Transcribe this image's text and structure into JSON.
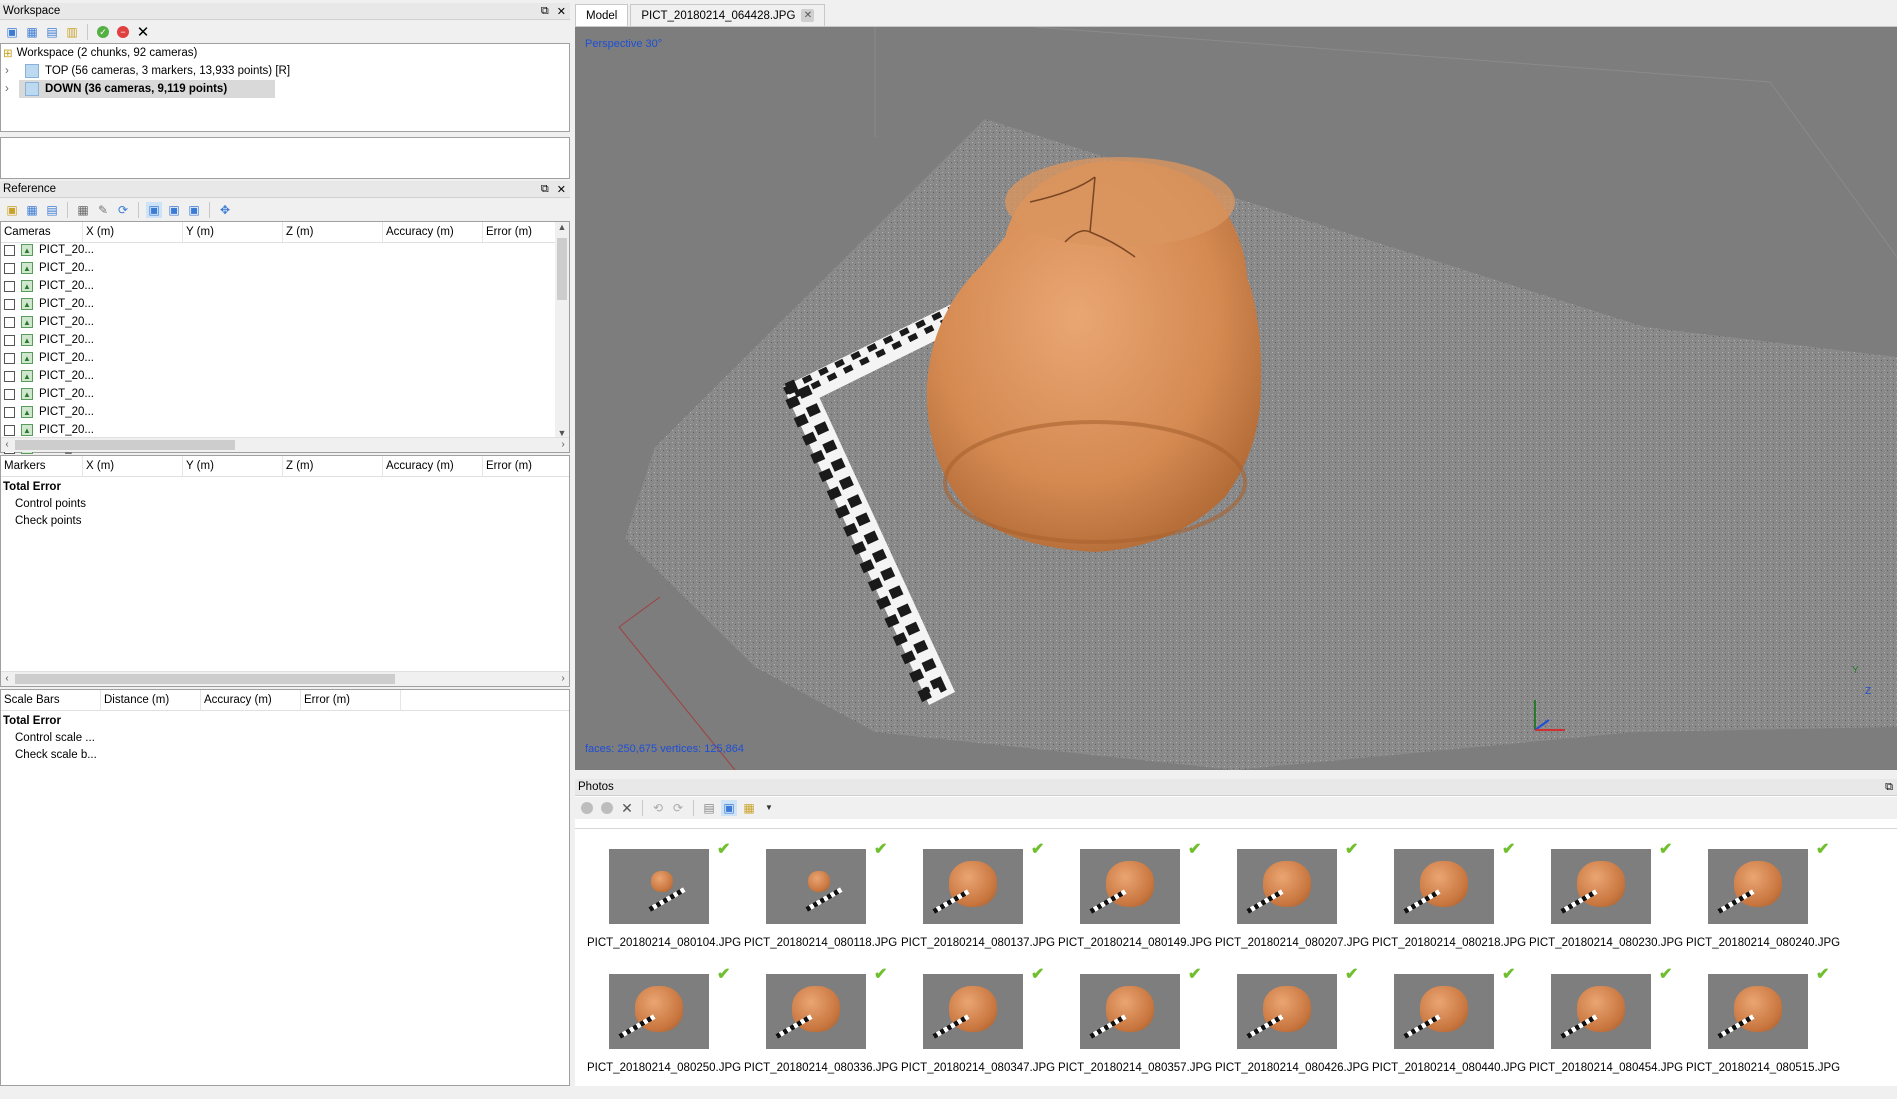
{
  "workspace": {
    "title": "Workspace",
    "root": "Workspace (2 chunks, 92 cameras)",
    "chunks": [
      {
        "label": "TOP (56 cameras, 3 markers, 13,933 points) [R]",
        "bold": false
      },
      {
        "label": "DOWN (36 cameras, 9,119 points)",
        "bold": true
      }
    ]
  },
  "reference": {
    "title": "Reference",
    "camera_columns": [
      "Cameras",
      "X (m)",
      "Y (m)",
      "Z (m)",
      "Accuracy (m)",
      "Error (m)"
    ],
    "cameras": [
      "PICT_20...",
      "PICT_20...",
      "PICT_20...",
      "PICT_20...",
      "PICT_20...",
      "PICT_20...",
      "PICT_20...",
      "PICT_20...",
      "PICT_20...",
      "PICT_20...",
      "PICT_20...",
      "PICT_20...",
      "PICT_20..."
    ],
    "marker_columns": [
      "Markers",
      "X (m)",
      "Y (m)",
      "Z (m)",
      "Accuracy (m)",
      "Error (m)"
    ],
    "marker_rows": [
      {
        "label": "Total Error",
        "bold": true
      },
      {
        "label": "Control points",
        "bold": false
      },
      {
        "label": "Check points",
        "bold": false
      }
    ],
    "scalebar_columns": [
      "Scale Bars",
      "Distance (m)",
      "Accuracy (m)",
      "Error (m)"
    ],
    "scalebar_rows": [
      {
        "label": "Total Error",
        "bold": true
      },
      {
        "label": "Control scale ...",
        "bold": false
      },
      {
        "label": "Check scale b...",
        "bold": false
      }
    ]
  },
  "tabs": [
    {
      "label": "Model",
      "active": true,
      "closable": false
    },
    {
      "label": "PICT_20180214_064428.JPG",
      "active": false,
      "closable": true
    }
  ],
  "viewport": {
    "projection": "Perspective 30°",
    "stats": "faces: 250,675 vertices: 125,864",
    "axis_labels": [
      "Y",
      "Z"
    ]
  },
  "photos": {
    "title": "Photos",
    "items": [
      {
        "name": "PICT_20180214_080104.JPG",
        "variant": "far"
      },
      {
        "name": "PICT_20180214_080118.JPG",
        "variant": "far"
      },
      {
        "name": "PICT_20180214_080137.JPG",
        "variant": "near"
      },
      {
        "name": "PICT_20180214_080149.JPG",
        "variant": "near"
      },
      {
        "name": "PICT_20180214_080207.JPG",
        "variant": "near"
      },
      {
        "name": "PICT_20180214_080218.JPG",
        "variant": "near"
      },
      {
        "name": "PICT_20180214_080230.JPG",
        "variant": "near"
      },
      {
        "name": "PICT_20180214_080240.JPG",
        "variant": "near"
      },
      {
        "name": "PICT_20180214_080250.JPG",
        "variant": "near"
      },
      {
        "name": "PICT_20180214_080336.JPG",
        "variant": "near"
      },
      {
        "name": "PICT_20180214_080347.JPG",
        "variant": "near"
      },
      {
        "name": "PICT_20180214_080357.JPG",
        "variant": "near"
      },
      {
        "name": "PICT_20180214_080426.JPG",
        "variant": "near"
      },
      {
        "name": "PICT_20180214_080440.JPG",
        "variant": "near"
      },
      {
        "name": "PICT_20180214_080454.JPG",
        "variant": "near"
      },
      {
        "name": "PICT_20180214_080515.JPG",
        "variant": "near"
      }
    ]
  },
  "colors": {
    "viewport_bg": "#7d7d7d",
    "overlay_text": "#1e4fd6",
    "check_green": "#6fbf2f",
    "pot": "#d58a52",
    "selection": "#d9d9d9"
  }
}
